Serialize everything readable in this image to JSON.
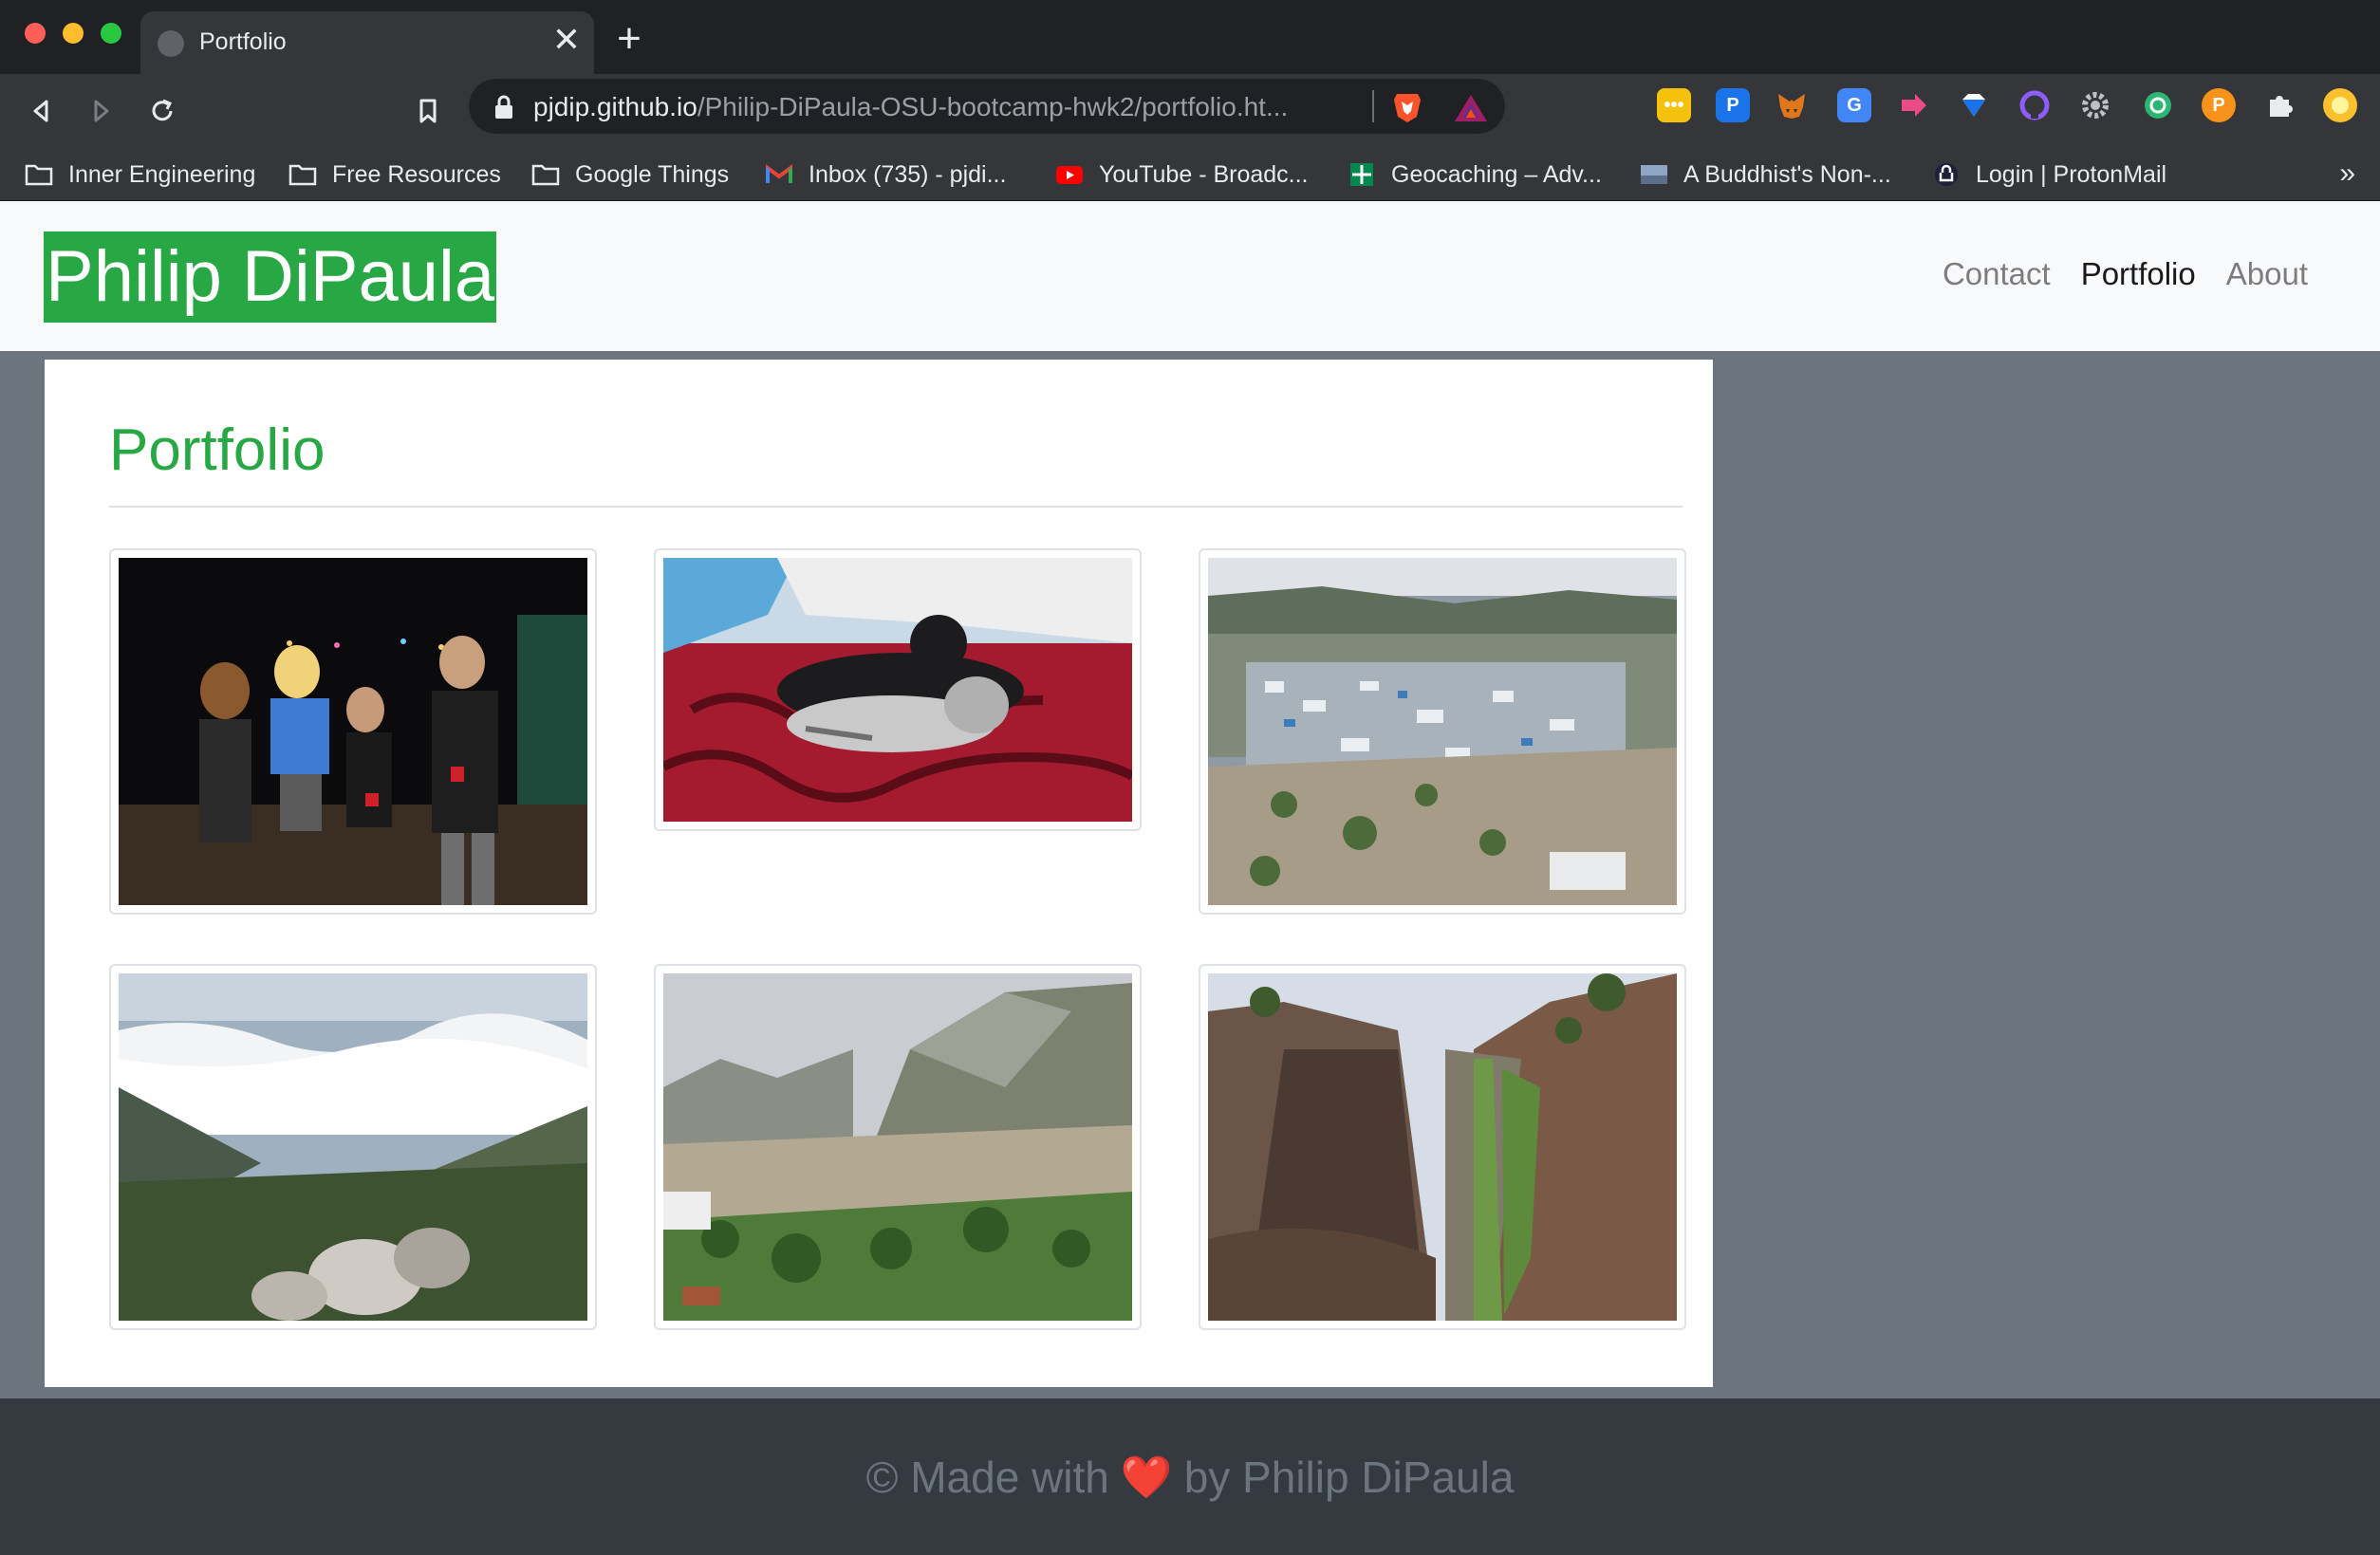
{
  "browser": {
    "tab_title": "Portfolio",
    "tab_close": "✕",
    "new_tab": "+",
    "url_host": "pjdip.github.io",
    "url_path": "/Philip-DiPaula-OSU-bootcamp-hwk2/portfolio.ht...",
    "bookmarks_more": "»"
  },
  "bookmarks": [
    {
      "label": "Inner Engineering",
      "icon": "folder-icon"
    },
    {
      "label": "Free Resources",
      "icon": "folder-icon"
    },
    {
      "label": "Google Things",
      "icon": "folder-icon"
    },
    {
      "label": "Inbox (735) - pjdi...",
      "icon": "gmail-icon"
    },
    {
      "label": "YouTube - Broadc...",
      "icon": "youtube-icon"
    },
    {
      "label": "Geocaching – Adv...",
      "icon": "geocaching-icon"
    },
    {
      "label": "A Buddhist's Non-...",
      "icon": "image-icon"
    },
    {
      "label": "Login | ProtonMail",
      "icon": "protonmail-icon"
    }
  ],
  "site": {
    "brand": "Philip DiPaula",
    "nav": [
      {
        "label": "Contact",
        "active": false
      },
      {
        "label": "Portfolio",
        "active": true
      },
      {
        "label": "About",
        "active": false
      }
    ],
    "heading": "Portfolio",
    "gallery": [
      {
        "name": "photo-night-party"
      },
      {
        "name": "photo-cats-on-blanket"
      },
      {
        "name": "photo-mountain-town"
      },
      {
        "name": "photo-clouds-valley"
      },
      {
        "name": "photo-rocky-mountain"
      },
      {
        "name": "photo-waterfall-cliff"
      }
    ],
    "footer": {
      "prefix": "© Made with",
      "heart": "❤️",
      "suffix": "by Philip DiPaula"
    }
  },
  "colors": {
    "brand_green": "#28a745",
    "page_bg": "#6c757d",
    "footer_bg": "#343a40"
  }
}
